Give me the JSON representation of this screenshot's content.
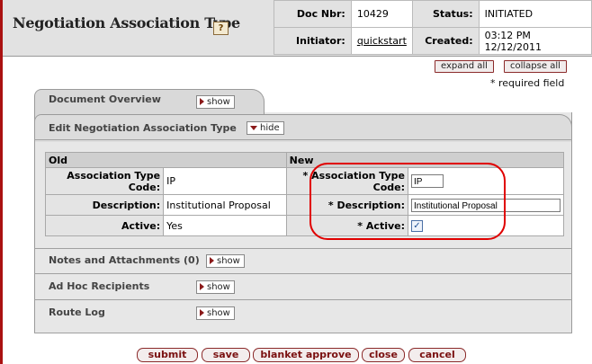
{
  "header": {
    "title": "Negotiation Association Type",
    "help_icon": "?",
    "doc_nbr_label": "Doc Nbr:",
    "doc_nbr": "10429",
    "status_label": "Status:",
    "status": "INITIATED",
    "initiator_label": "Initiator:",
    "initiator": "quickstart",
    "created_label": "Created:",
    "created": "03:12 PM 12/12/2011"
  },
  "top_actions": {
    "expand_all": "expand all",
    "collapse_all": "collapse all",
    "required_note": "* required field"
  },
  "tabs": {
    "document_overview": {
      "title": "Document Overview",
      "toggle": "show"
    },
    "edit": {
      "title": "Edit Negotiation Association Type",
      "toggle": "hide"
    },
    "notes": {
      "title": "Notes and Attachments (0)",
      "toggle": "show"
    },
    "adhoc": {
      "title": "Ad Hoc Recipients",
      "toggle": "show"
    },
    "route_log": {
      "title": "Route Log",
      "toggle": "show"
    }
  },
  "edit_table": {
    "old_header": "Old",
    "new_header": "New",
    "rows": [
      {
        "label_old": "Association Type Code:",
        "value_old": "IP",
        "req": "*",
        "label_new": "Association Type Code:",
        "value_new": "IP"
      },
      {
        "label_old": "Description:",
        "value_old": "Institutional Proposal",
        "req": "*",
        "label_new": "Description:",
        "value_new": "Institutional Proposal"
      },
      {
        "label_old": "Active:",
        "value_old": "Yes",
        "req": "*",
        "label_new": "Active:",
        "value_new": "✓"
      }
    ]
  },
  "bottom_buttons": {
    "submit": "submit",
    "save": "save",
    "blanket_approve": "blanket approve",
    "close": "close",
    "cancel": "cancel"
  }
}
